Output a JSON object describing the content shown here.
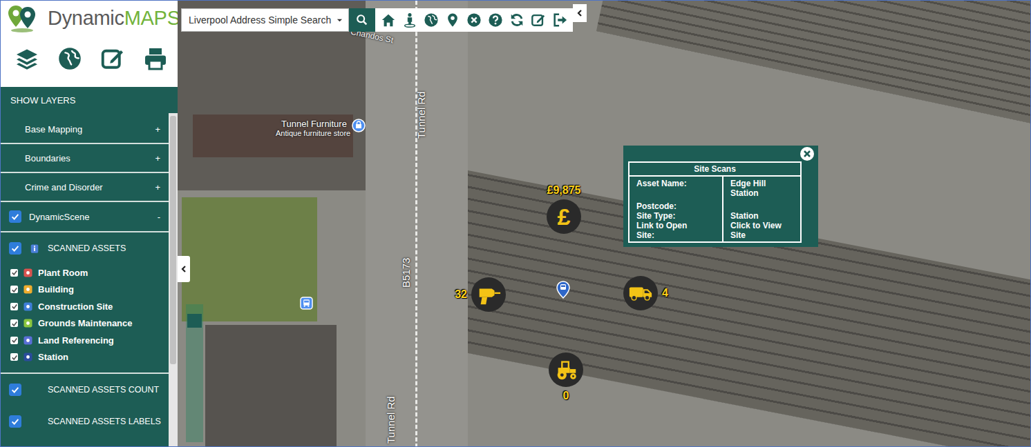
{
  "logo": {
    "text_dark": "Dynamic",
    "text_light": "MAPS"
  },
  "search": {
    "value": "Liverpool Address Simple Search"
  },
  "sidebar": {
    "header": "SHOW LAYERS",
    "groups": [
      {
        "label": "Base Mapping",
        "toggle": "+"
      },
      {
        "label": "Boundaries",
        "toggle": "+"
      },
      {
        "label": "Crime and Disorder",
        "toggle": "+"
      }
    ],
    "scene": {
      "label": "DynamicScene",
      "toggle": "-",
      "checked": true,
      "sections": [
        {
          "label": "SCANNED ASSETS",
          "kind": "with-icon",
          "checked": true,
          "items": [
            {
              "label": "Plant Room",
              "checked": true,
              "color": "#d9534f"
            },
            {
              "label": "Building",
              "checked": true,
              "color": "#f0ad2e"
            },
            {
              "label": "Construction Site",
              "checked": true,
              "color": "#3f7fd8"
            },
            {
              "label": "Grounds Maintenance",
              "checked": true,
              "color": "#8cc63f"
            },
            {
              "label": "Land Referencing",
              "checked": true,
              "color": "#5a6fd6"
            },
            {
              "label": "Station",
              "checked": true,
              "color": "#2a4c9c"
            }
          ]
        },
        {
          "label": "SCANNED ASSETS COUNT",
          "kind": "plain",
          "checked": true,
          "items": []
        },
        {
          "label": "SCANNED ASSETS LABELS",
          "kind": "plain",
          "checked": true,
          "items": []
        }
      ]
    }
  },
  "map": {
    "labels": [
      {
        "text": "Chandos St",
        "kind": "street"
      },
      {
        "text": "Tunnel Rd",
        "kind": "road"
      },
      {
        "text": "Tunnel Furniture",
        "kind": "place"
      },
      {
        "text": "Antique furniture store",
        "kind": "place-sub"
      },
      {
        "text": "B5173",
        "kind": "road"
      },
      {
        "text": "Tunnel Rd",
        "kind": "road"
      }
    ],
    "markers": [
      {
        "kind": "money",
        "glyph": "£",
        "label": "£9,875"
      },
      {
        "kind": "drill",
        "label": "32"
      },
      {
        "kind": "van",
        "label": "4"
      },
      {
        "kind": "tractor",
        "label": "0"
      }
    ],
    "popup": {
      "title": "Site Scans",
      "rows": [
        {
          "label": "Asset Name:",
          "value": "Edge Hill Station"
        },
        {
          "label": "Postcode:",
          "value": ""
        },
        {
          "label": "Site Type:",
          "value": "Station"
        },
        {
          "label": "Link to Open Site:",
          "value": "Click to View Site"
        }
      ]
    },
    "slider": {
      "level": 0.92
    }
  }
}
